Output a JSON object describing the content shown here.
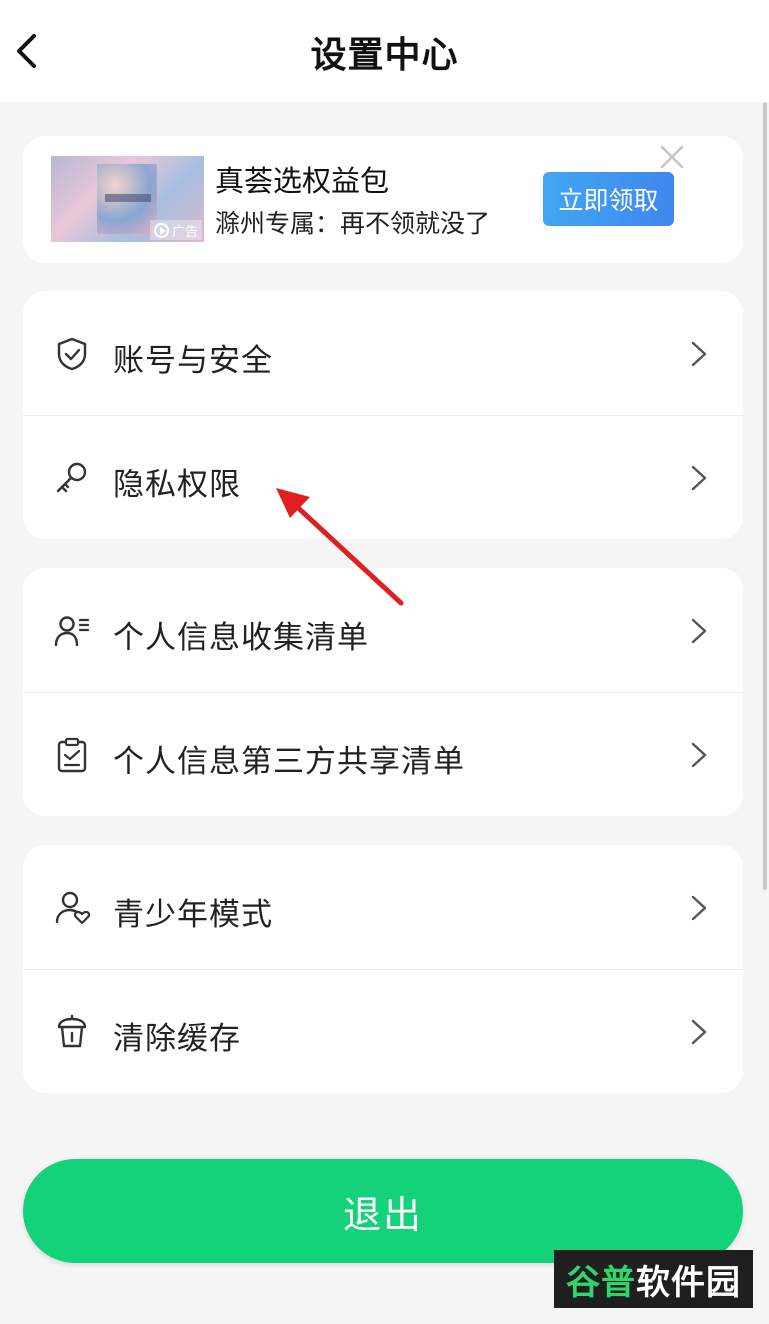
{
  "header": {
    "title": "设置中心",
    "back_icon": "chevron-left-icon"
  },
  "ad": {
    "title": "真荟选权益包",
    "subtitle": "滁州专属：再不领就没了",
    "cta": "立即领取",
    "badge": "广告",
    "close_icon": "close-icon"
  },
  "groups": [
    {
      "items": [
        {
          "label": "账号与安全",
          "icon": "shield-icon"
        },
        {
          "label": "隐私权限",
          "icon": "key-icon"
        }
      ]
    },
    {
      "items": [
        {
          "label": "个人信息收集清单",
          "icon": "user-list-icon"
        },
        {
          "label": "个人信息第三方共享清单",
          "icon": "clipboard-icon"
        }
      ]
    },
    {
      "items": [
        {
          "label": "青少年模式",
          "icon": "user-heart-icon"
        },
        {
          "label": "清除缓存",
          "icon": "trash-icon"
        }
      ]
    }
  ],
  "logout": {
    "label": "退出"
  },
  "watermark": {
    "part1": "谷普",
    "part2": "软件园"
  },
  "colors": {
    "accent": "#14d27a",
    "cta": "#3f8ef0",
    "annotation_arrow": "#e02020"
  }
}
